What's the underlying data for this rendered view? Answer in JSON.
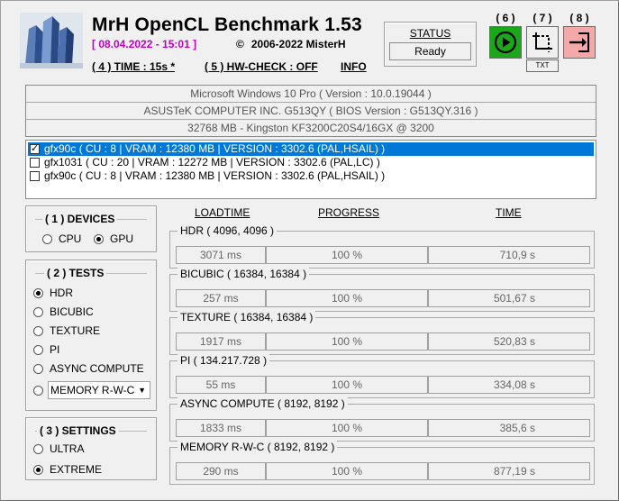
{
  "header": {
    "title": "MrH OpenCL Benchmark 1.53",
    "datetime": "[ 08.04.2022 - 15:01 ]",
    "copyright_symbol": "©",
    "copyright": "2006-2022 MisterH",
    "time_link": "( 4 ) TIME : 15s *",
    "hwcheck_link": "( 5 ) HW-CHECK : OFF",
    "info_link": "INFO"
  },
  "status": {
    "label": "STATUS",
    "value": "Ready"
  },
  "buttons": {
    "run": {
      "number": "( 6 )",
      "icon": "play-icon"
    },
    "screenshot": {
      "number": "( 7 )",
      "icon": "screenshot-crop-icon",
      "sub": "TXT"
    },
    "exit": {
      "number": "( 8 )",
      "icon": "exit-icon"
    }
  },
  "system": [
    "Microsoft Windows 10 Pro ( Version : 10.0.19044 )",
    "ASUSTeK COMPUTER INC. G513QY ( BIOS Version : G513QY.316 )",
    "32768 MB - Kingston KF3200C20S4/16GX    @ 3200"
  ],
  "devices": [
    {
      "label": "gfx90c ( CU : 8 | VRAM : 12380 MB | VERSION : 3302.6 (PAL,HSAIL) )",
      "checked": true,
      "selected": true
    },
    {
      "label": "gfx1031 ( CU : 20 | VRAM : 12272 MB | VERSION : 3302.6 (PAL,LC) )",
      "checked": false,
      "selected": false
    },
    {
      "label": "gfx90c ( CU : 8 | VRAM : 12380 MB | VERSION : 3302.6 (PAL,HSAIL) )",
      "checked": false,
      "selected": false
    }
  ],
  "devices_group": {
    "title": "( 1 ) DEVICES",
    "options": [
      {
        "label": "CPU",
        "on": false
      },
      {
        "label": "GPU",
        "on": true
      }
    ]
  },
  "tests_group": {
    "title": "( 2 ) TESTS",
    "options": [
      {
        "label": "HDR",
        "on": true
      },
      {
        "label": "BICUBIC",
        "on": false
      },
      {
        "label": "TEXTURE",
        "on": false
      },
      {
        "label": "PI",
        "on": false
      },
      {
        "label": "ASYNC COMPUTE",
        "on": false
      }
    ],
    "memory_option": {
      "label": "MEMORY R-W-C",
      "on": false
    }
  },
  "settings_group": {
    "title": "( 3 ) SETTINGS",
    "options": [
      {
        "label": "ULTRA",
        "on": false
      },
      {
        "label": "EXTREME",
        "on": true
      }
    ]
  },
  "columns": {
    "loadtime": "LOADTIME",
    "progress": "PROGRESS",
    "time": "TIME"
  },
  "results": [
    {
      "name": "HDR ( 4096, 4096 )",
      "loadtime": "3071 ms",
      "progress": "100 %",
      "time": "710,9 s"
    },
    {
      "name": "BICUBIC ( 16384, 16384 )",
      "loadtime": "257 ms",
      "progress": "100 %",
      "time": "501,67 s"
    },
    {
      "name": "TEXTURE ( 16384, 16384 )",
      "loadtime": "1917 ms",
      "progress": "100 %",
      "time": "520,83 s"
    },
    {
      "name": "PI ( 134.217.728 )",
      "loadtime": "55 ms",
      "progress": "100 %",
      "time": "334,08 s"
    },
    {
      "name": "ASYNC COMPUTE ( 8192, 8192 )",
      "loadtime": "1833 ms",
      "progress": "100 %",
      "time": "385,6 s"
    },
    {
      "name": "MEMORY R-W-C ( 8192, 8192 )",
      "loadtime": "290 ms",
      "progress": "100 %",
      "time": "877,19 s"
    }
  ],
  "colors": {
    "run_button": "#1aa81a",
    "exit_button": "#f4a8a8",
    "date_text": "#c000c0",
    "selection": "#0078d7"
  }
}
